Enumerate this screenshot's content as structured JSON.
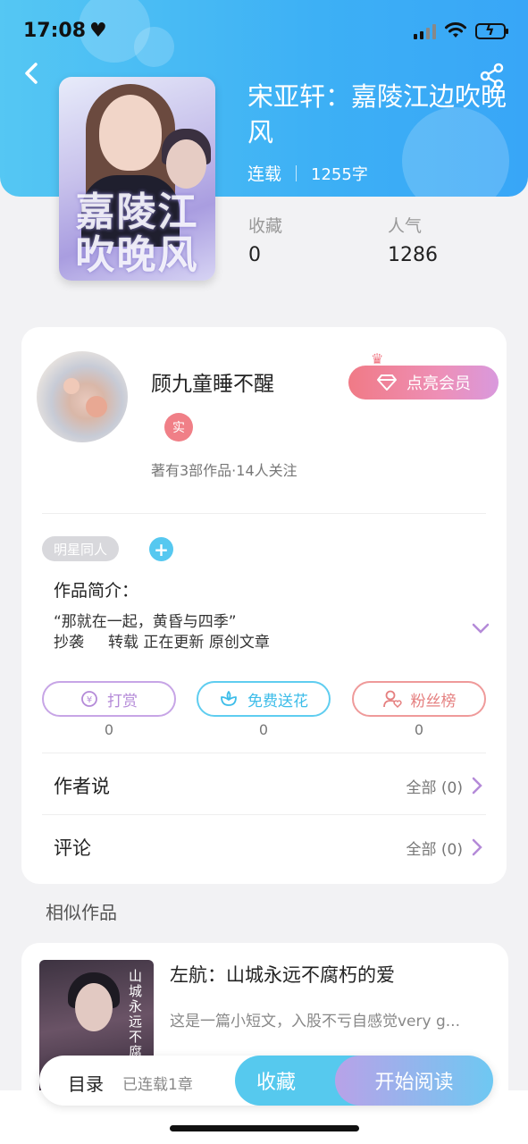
{
  "status_bar": {
    "time": "17:08"
  },
  "book": {
    "title": "宋亚轩：嘉陵江边吹晚风",
    "status": "连载",
    "word_count": "1255字",
    "cover_text": "嘉陵江吹晚风",
    "stats": [
      {
        "label": "收藏",
        "value": "0"
      },
      {
        "label": "人气",
        "value": "1286"
      }
    ]
  },
  "author": {
    "name": "顾九童睡不醒",
    "vip_button": "点亮会员",
    "badge": "实",
    "works_line": "著有3部作品·14人关注"
  },
  "tags": {
    "category": "明星同人",
    "add": "+"
  },
  "intro": {
    "heading": "作品简介：",
    "quote": "“那就在一起，黄昏与四季”",
    "tags_line": "抄袭     转载 正在更新 原创文章"
  },
  "actions": [
    {
      "label": "打赏",
      "count": "0",
      "icon": "yuan-icon"
    },
    {
      "label": "免费送花",
      "count": "0",
      "icon": "flower-icon"
    },
    {
      "label": "粉丝榜",
      "count": "0",
      "icon": "fan-icon"
    }
  ],
  "rows": [
    {
      "title": "作者说",
      "right": "全部 (0)"
    },
    {
      "title": "评论",
      "right": "全部 (0)"
    }
  ],
  "similar": {
    "heading": "相似作品",
    "items": [
      {
        "title": "左航：山城永远不腐朽的爱",
        "desc": "这是一篇小短文，入股不亏自感觉very g...",
        "cover_text": "山城永远不腐"
      }
    ]
  },
  "bottom": {
    "toc": "目录",
    "chapters": "已连载1章",
    "favorite": "收藏",
    "read": "开始阅读"
  },
  "colors": {
    "accent_blue": "#3db0f5",
    "vip_pink": "#f07a86",
    "purple": "#b48ad8"
  }
}
